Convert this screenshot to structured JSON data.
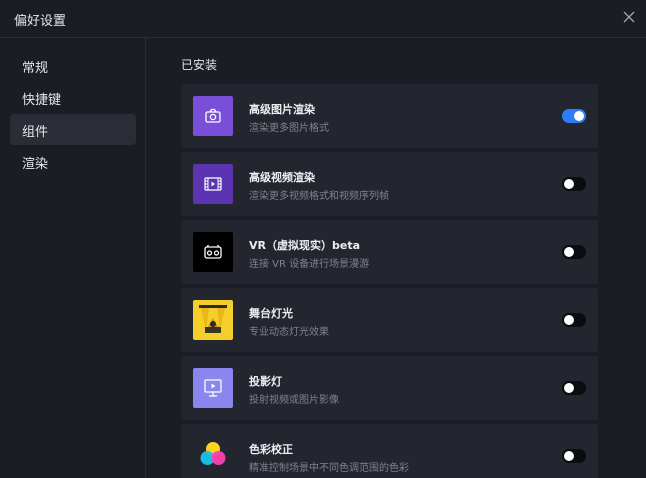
{
  "window": {
    "title": "偏好设置"
  },
  "sidebar": {
    "items": [
      {
        "label": "常规",
        "active": false
      },
      {
        "label": "快捷键",
        "active": false
      },
      {
        "label": "组件",
        "active": true
      },
      {
        "label": "渲染",
        "active": false
      }
    ]
  },
  "main": {
    "section_title": "已安装",
    "plugins": [
      {
        "title": "高级图片渲染",
        "desc": "渲染更多图片格式",
        "enabled": true,
        "icon": "camera-icon",
        "color": "#7a4fd8"
      },
      {
        "title": "高级视频渲染",
        "desc": "渲染更多视频格式和视频序列帧",
        "enabled": false,
        "icon": "film-icon",
        "color": "#5b35b1"
      },
      {
        "title": "VR（虚拟现实）beta",
        "desc": "连接 VR 设备进行场景漫游",
        "enabled": false,
        "icon": "vr-headset-icon",
        "color": "#000000"
      },
      {
        "title": "舞台灯光",
        "desc": "专业动态灯光效果",
        "enabled": false,
        "icon": "stage-light-icon",
        "color": "#f4cf2b"
      },
      {
        "title": "投影灯",
        "desc": "投射视频或图片影像",
        "enabled": false,
        "icon": "projector-icon",
        "color": "#8b86ef"
      },
      {
        "title": "色彩校正",
        "desc": "精准控制场景中不同色调范围的色彩",
        "enabled": false,
        "icon": "color-wheel-icon",
        "color": "#23262e"
      }
    ]
  },
  "colors": {
    "accent": "#2f7cf6",
    "background": "#1b1d24",
    "card": "#23262e"
  }
}
